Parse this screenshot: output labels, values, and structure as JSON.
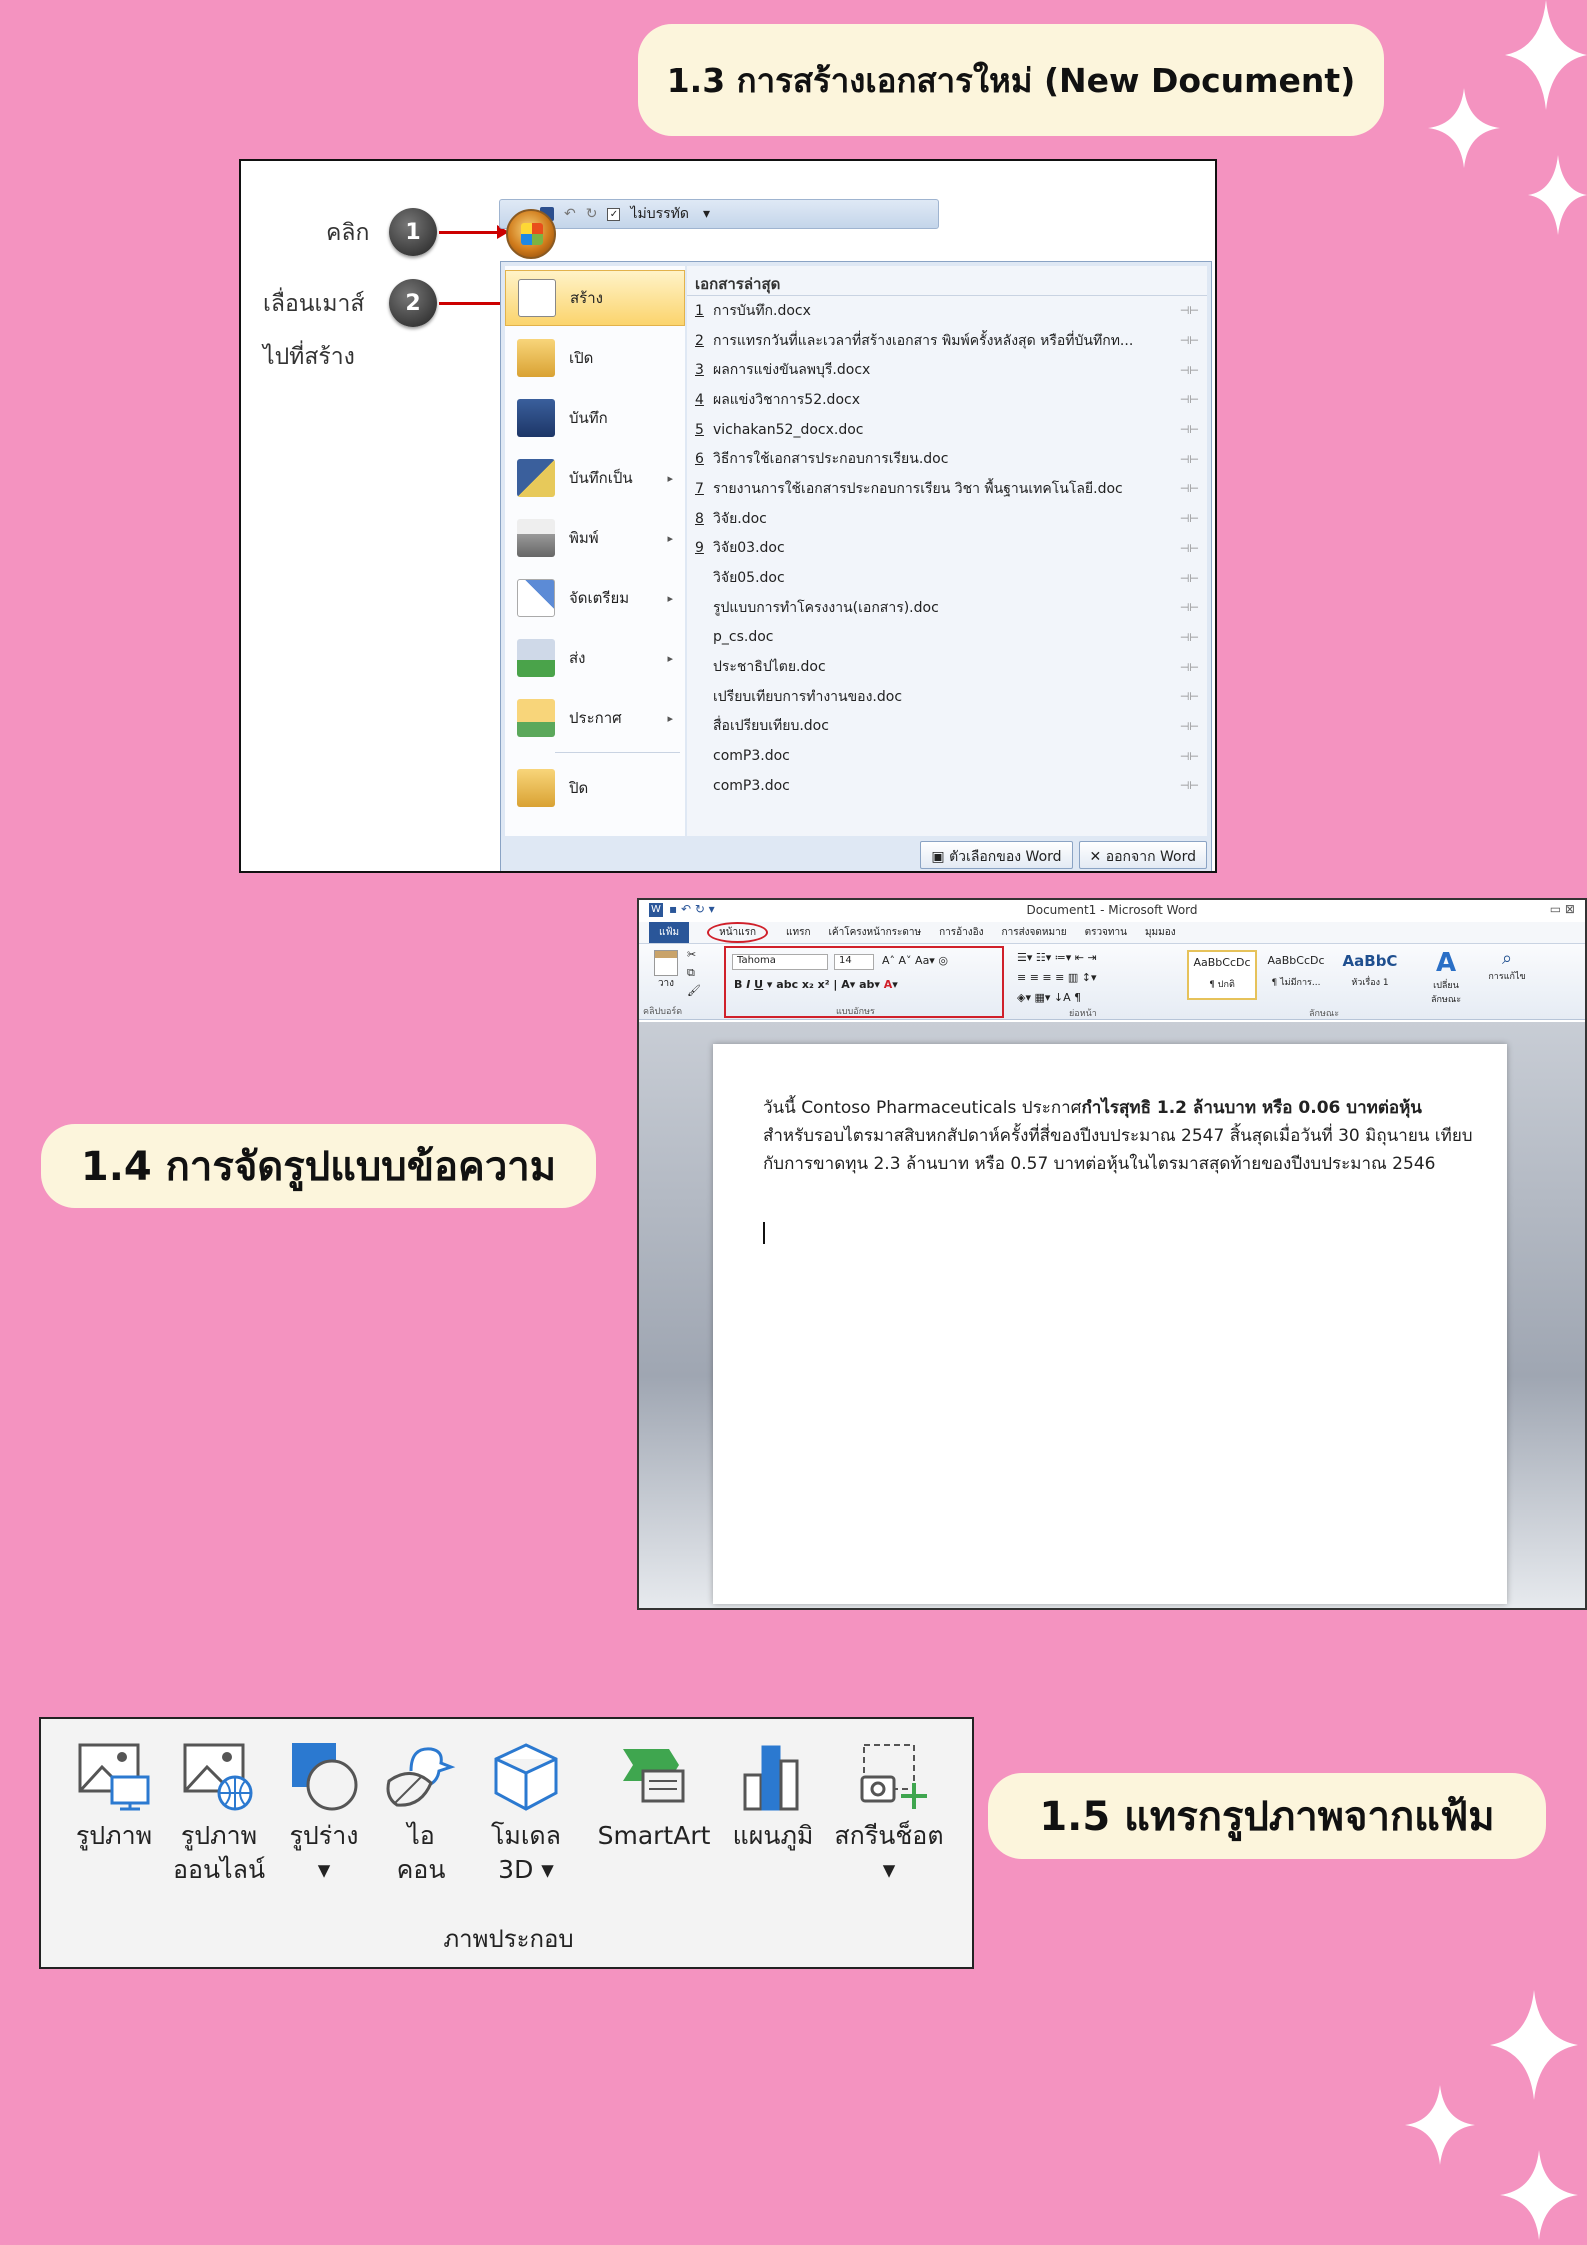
{
  "headings": {
    "section13": "1.3 การสร้างเอกสารใหม่ (New Document)",
    "section14": "1.4 การจัดรูปแบบข้อความ",
    "section15": "1.5 แทรกรูปภาพจากแฟ้ม"
  },
  "office_menu": {
    "annotations": {
      "click": "คลิก",
      "move_line1": "เลื่อนเมาส์",
      "move_line2": "ไปที่สร้าง",
      "step1": "1",
      "step2": "2"
    },
    "qat_label": "ไม่บรรทัด",
    "left_items": [
      {
        "label": "สร้าง",
        "submenu": ""
      },
      {
        "label": "เปิด",
        "submenu": ""
      },
      {
        "label": "บันทึก",
        "submenu": ""
      },
      {
        "label": "บันทึกเป็น",
        "submenu": "▸"
      },
      {
        "label": "พิมพ์",
        "submenu": "▸"
      },
      {
        "label": "จัดเตรียม",
        "submenu": "▸"
      },
      {
        "label": "ส่ง",
        "submenu": "▸"
      },
      {
        "label": "ประกาศ",
        "submenu": "▸"
      },
      {
        "label": "ปิด",
        "submenu": ""
      }
    ],
    "recent_header": "เอกสารล่าสุด",
    "recent_docs": [
      {
        "num": "1",
        "name": "การบันทึก.docx"
      },
      {
        "num": "2",
        "name": "การแทรกวันที่และเวลาที่สร้างเอกสาร พิมพ์ครั้งหลังสุด หรือที่บันทึกท..."
      },
      {
        "num": "3",
        "name": "ผลการแข่งขันลพบุรี.docx"
      },
      {
        "num": "4",
        "name": "ผลแข่งวิชาการ52.docx"
      },
      {
        "num": "5",
        "name": "vichakan52_docx.doc"
      },
      {
        "num": "6",
        "name": "วิธีการใช้เอกสารประกอบการเรียน.doc"
      },
      {
        "num": "7",
        "name": "รายงานการใช้เอกสารประกอบการเรียน วิชา พื้นฐานเทคโนโลยี.doc"
      },
      {
        "num": "8",
        "name": "วิจัย.doc"
      },
      {
        "num": "9",
        "name": "วิจัย03.doc"
      },
      {
        "num": "",
        "name": "วิจัย05.doc"
      },
      {
        "num": "",
        "name": "รูปแบบการทำโครงงาน(เอกสาร).doc"
      },
      {
        "num": "",
        "name": "p_cs.doc"
      },
      {
        "num": "",
        "name": "ประชาธิปไตย.doc"
      },
      {
        "num": "",
        "name": "เปรียบเทียบการทำงานของ.doc"
      },
      {
        "num": "",
        "name": "สื่อเปรียบเทียบ.doc"
      },
      {
        "num": "",
        "name": "comP3.doc"
      },
      {
        "num": "",
        "name": "comP3.doc"
      }
    ],
    "footer": {
      "options": "ตัวเลือกของ Word",
      "exit": "ออกจาก Word"
    }
  },
  "word": {
    "title": "Document1 - Microsoft Word",
    "tabs": [
      "แฟ้ม",
      "หน้าแรก",
      "แทรก",
      "เค้าโครงหน้ากระดาษ",
      "การอ้างอิง",
      "การส่งจดหมาย",
      "ตรวจทาน",
      "มุมมอง"
    ],
    "font_name": "Tahoma",
    "font_size": "14",
    "group_labels": [
      "คลิปบอร์ด",
      "แบบอักษร",
      "ย่อหน้า",
      "ลักษณะ"
    ],
    "styles": [
      {
        "preview": "AaBbCcDc",
        "name": "¶ ปกติ"
      },
      {
        "preview": "AaBbCcDc",
        "name": "¶ ไม่มีการ..."
      },
      {
        "preview": "AaBbC",
        "name": "หัวเรื่อง 1"
      }
    ],
    "change_styles": "เปลี่ยนลักษณะ",
    "editing": "การแก้ไข",
    "paste": "วาง",
    "body_part1": "วันนี้ Contoso Pharmaceuticals  ประกาศ",
    "body_bold": "กำไรสุทธิ 1.2 ล้านบาท หรือ 0.06 บาทต่อหุ้น",
    "body_part2": " สำหรับรอบไตรมาสสิบหกสัปดาห์ครั้งที่สี่ของปีงบประมาณ 2547 สิ้นสุดเมื่อวันที่ 30 มิถุนายน เทียบกับการขาดทุน 2.3 ล้านบาท หรือ 0.57 บาทต่อหุ้นในไตรมาสสุดท้ายของปีงบประมาณ 2546"
  },
  "insert_ribbon": {
    "buttons": [
      {
        "line1": "รูปภาพ",
        "line2": ""
      },
      {
        "line1": "รูปภาพ",
        "line2": "ออนไลน์"
      },
      {
        "line1": "รูปร่าง",
        "line2": "▾"
      },
      {
        "line1": "ไอ",
        "line2": "คอน"
      },
      {
        "line1": "โมเดล",
        "line2": "3D ▾"
      },
      {
        "line1": "SmartArt",
        "line2": ""
      },
      {
        "line1": "แผนภูมิ",
        "line2": ""
      },
      {
        "line1": "สกรีนช็อต",
        "line2": "▾"
      }
    ],
    "group_label": "ภาพประกอบ"
  }
}
